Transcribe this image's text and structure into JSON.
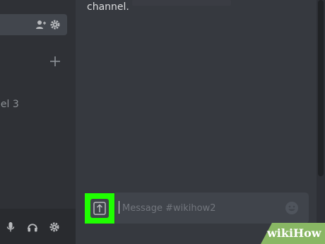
{
  "app": {
    "theme": {
      "accent": "#1fff00",
      "background": "#36393f",
      "sidebar": "#2f3136"
    }
  },
  "sidebar": {
    "channel_label": "nel 3",
    "add_icon": "plus-icon",
    "row_icons": [
      "add-friend-icon",
      "gear-icon"
    ],
    "panel_icons": [
      "microphone-icon",
      "headphones-icon",
      "gear-icon"
    ]
  },
  "chat": {
    "message_fragment": "channel."
  },
  "composer": {
    "placeholder": "Message #wikihow2",
    "upload_icon": "upload-icon",
    "emoji_icon": "emoji-icon"
  },
  "watermark": {
    "wiki": "wiki",
    "how": "How"
  }
}
